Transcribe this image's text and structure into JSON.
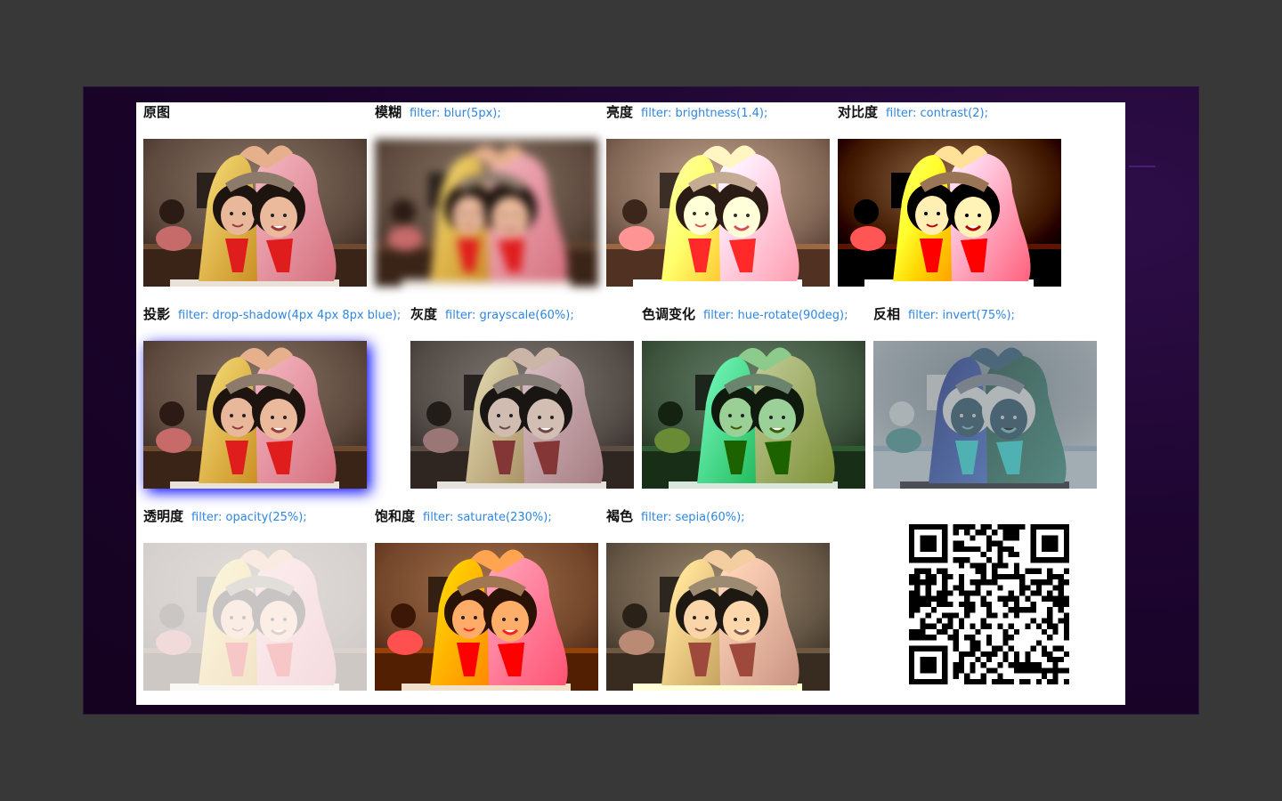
{
  "cells": [
    {
      "title": "原图",
      "code": ""
    },
    {
      "title": "模糊",
      "code": "filter: blur(5px);"
    },
    {
      "title": "亮度",
      "code": "filter: brightness(1.4);"
    },
    {
      "title": "对比度",
      "code": "filter: contrast(2);"
    },
    {
      "title": "投影",
      "code": "filter: drop-shadow(4px 4px 8px blue);"
    },
    {
      "title": "灰度",
      "code": "filter: grayscale(60%);"
    },
    {
      "title": "色调变化",
      "code": "filter: hue-rotate(90deg);"
    },
    {
      "title": "反相",
      "code": "filter: invert(75%);"
    },
    {
      "title": "透明度",
      "code": "filter: opacity(25%);"
    },
    {
      "title": "饱和度",
      "code": "filter: saturate(230%);"
    },
    {
      "title": "褐色",
      "code": "filter: sepia(60%);"
    }
  ],
  "colors": {
    "page_bg": "#383838",
    "stage_bg": "#1d0530",
    "panel_bg": "#ffffff",
    "caption": "#111111",
    "code": "#2e86e0"
  },
  "qr": {
    "icon": "qr-code-icon"
  }
}
